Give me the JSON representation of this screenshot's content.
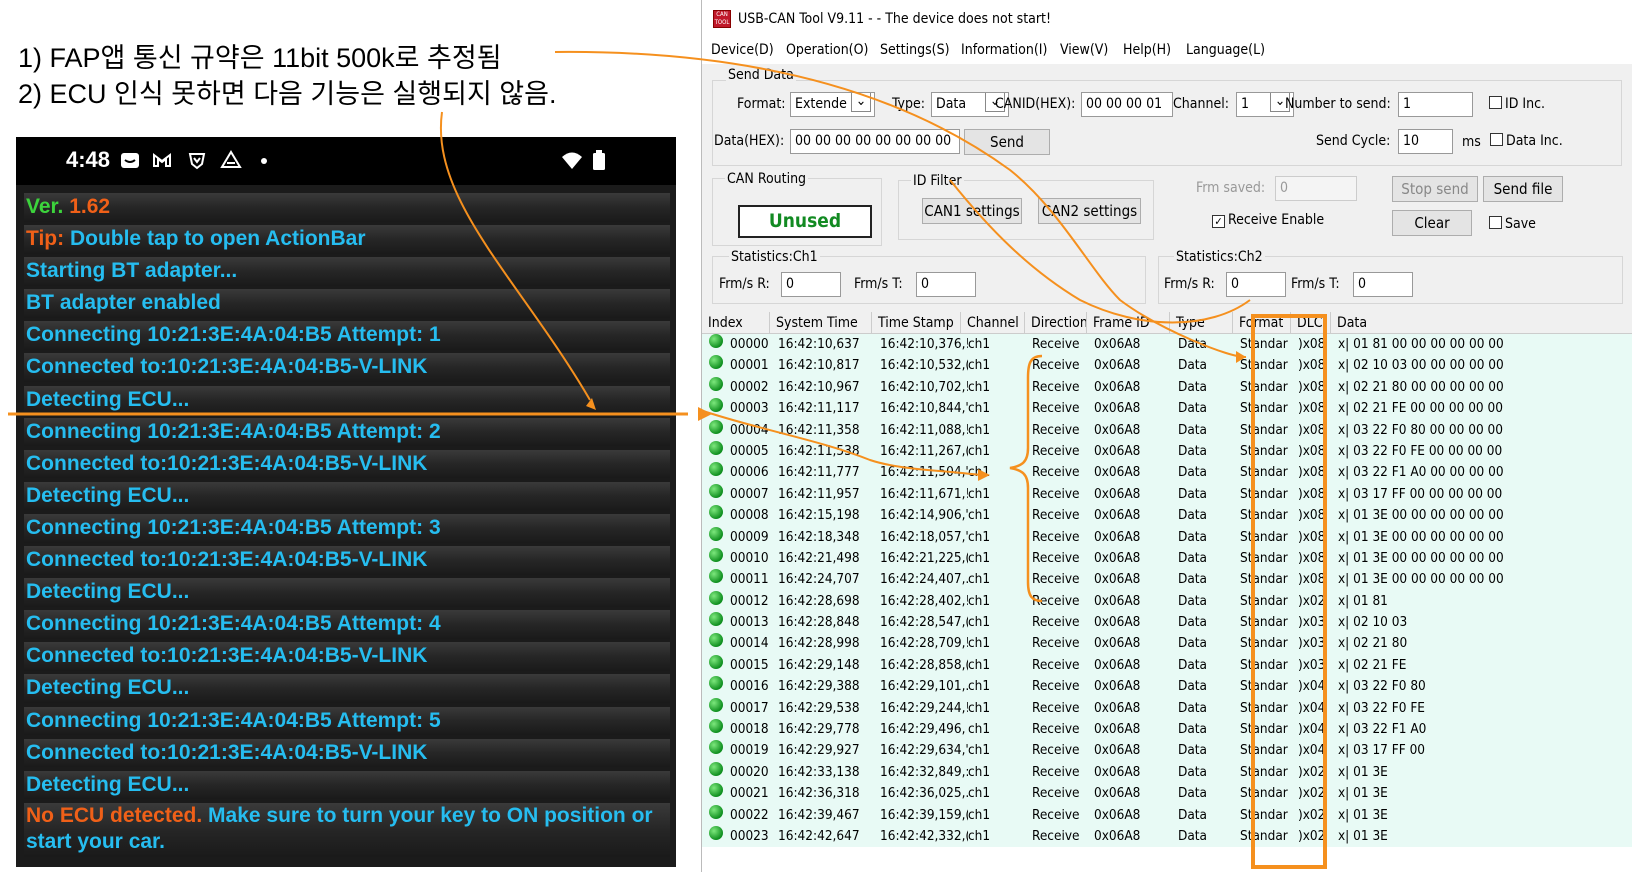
{
  "notes": [
    "1) FAP앱 통신 규약은 11bit 500k로 추정됨",
    "2) ECU 인식 못하면 다음 기능은 실행되지 않음."
  ],
  "phone": {
    "time": "4:48",
    "status_icons": [
      "notification-icon",
      "gmail-icon",
      "vpn-icon",
      "drive-icon",
      "dot-icon",
      "wifi-icon",
      "battery-icon"
    ],
    "log": [
      {
        "a": "Ver. ",
        "b": "1.62",
        "ac": "grn",
        "bc": "org"
      },
      {
        "a": "Tip: ",
        "b": "Double tap to open ActionBar",
        "ac": "org",
        "bc": ""
      },
      {
        "a": "Starting BT adapter...",
        "b": "",
        "ac": "",
        "bc": ""
      },
      {
        "a": "BT adapter enabled",
        "b": "",
        "ac": "",
        "bc": ""
      },
      {
        "a": "Connecting 10:21:3E:4A:04:B5 Attempt: 1",
        "b": "",
        "ac": "",
        "bc": ""
      },
      {
        "a": "Connected to:10:21:3E:4A:04:B5-V-LINK",
        "b": "",
        "ac": "",
        "bc": ""
      },
      {
        "a": "Detecting ECU...",
        "b": "",
        "ac": "",
        "bc": ""
      },
      {
        "a": "Connecting 10:21:3E:4A:04:B5 Attempt: 2",
        "b": "",
        "ac": "",
        "bc": ""
      },
      {
        "a": "Connected to:10:21:3E:4A:04:B5-V-LINK",
        "b": "",
        "ac": "",
        "bc": ""
      },
      {
        "a": "Detecting ECU...",
        "b": "",
        "ac": "",
        "bc": ""
      },
      {
        "a": "Connecting 10:21:3E:4A:04:B5 Attempt: 3",
        "b": "",
        "ac": "",
        "bc": ""
      },
      {
        "a": "Connected to:10:21:3E:4A:04:B5-V-LINK",
        "b": "",
        "ac": "",
        "bc": ""
      },
      {
        "a": "Detecting ECU...",
        "b": "",
        "ac": "",
        "bc": ""
      },
      {
        "a": "Connecting 10:21:3E:4A:04:B5 Attempt: 4",
        "b": "",
        "ac": "",
        "bc": ""
      },
      {
        "a": "Connected to:10:21:3E:4A:04:B5-V-LINK",
        "b": "",
        "ac": "",
        "bc": ""
      },
      {
        "a": "Detecting ECU...",
        "b": "",
        "ac": "",
        "bc": ""
      },
      {
        "a": "Connecting 10:21:3E:4A:04:B5 Attempt: 5",
        "b": "",
        "ac": "",
        "bc": ""
      },
      {
        "a": "Connected to:10:21:3E:4A:04:B5-V-LINK",
        "b": "",
        "ac": "",
        "bc": ""
      },
      {
        "a": "Detecting ECU...",
        "b": "",
        "ac": "",
        "bc": ""
      },
      {
        "a": "No ECU detected. ",
        "b": "Make sure to turn your key to ON position or start your car.",
        "ac": "org",
        "bc": ""
      }
    ]
  },
  "win": {
    "title": "USB-CAN Tool V9.11 -  - The device does not start!",
    "menu": [
      "Device(D)",
      "Operation(O)",
      "Settings(S)",
      "Information(I)",
      "View(V)",
      "Help(H)",
      "Language(L)"
    ],
    "send": {
      "group": "Send Data",
      "format_label": "Format:",
      "format": "Extende",
      "type_label": "Type:",
      "type": "Data",
      "canid_label": "CANID(HEX):",
      "canid": "00 00 00 01",
      "channel_label": "Channel:",
      "channel": "1",
      "number_label": "Number to send:",
      "number": "1",
      "idinc": "ID Inc.",
      "data_label": "Data(HEX):",
      "data": "00 00 00 00 00 00 00 00",
      "send_btn": "Send",
      "cycle_label": "Send Cycle:",
      "cycle": "10",
      "ms": "ms",
      "datainc": "Data Inc."
    },
    "routing": {
      "group": "CAN Routing",
      "value": "Unused"
    },
    "filter": {
      "group": "ID Filter",
      "can1": "CAN1 settings",
      "can2": "CAN2 settings"
    },
    "frm_saved_label": "Frm saved:",
    "frm_saved": "0",
    "stop_send": "Stop send",
    "send_file": "Send file",
    "receive_enable": "Receive Enable",
    "clear": "Clear",
    "save": "Save",
    "stat1": {
      "group": "Statistics:Ch1",
      "r_label": "Frm/s R:",
      "r": "0",
      "t_label": "Frm/s T:",
      "t": "0"
    },
    "stat2": {
      "group": "Statistics:Ch2",
      "r_label": "Frm/s R:",
      "r": "0",
      "t_label": "Frm/s T:",
      "t": "0"
    },
    "columns": [
      "Index",
      "System Time",
      "Time Stamp",
      "Channel",
      "Direction",
      "Frame ID",
      "Type",
      "Format",
      "DLC",
      "Data"
    ],
    "rows": [
      [
        "00000",
        "16:42:10,637",
        "16:42:10,376,!",
        "ch1",
        "Receive",
        "0x06A8",
        "Data",
        "Standar",
        ")x08",
        "x| 01 81 00 00 00 00 00 00"
      ],
      [
        "00001",
        "16:42:10,817",
        "16:42:10,532,(",
        "ch1",
        "Receive",
        "0x06A8",
        "Data",
        "Standar",
        ")x08",
        "x| 02 10 03 00 00 00 00 00"
      ],
      [
        "00002",
        "16:42:10,967",
        "16:42:10,702,!",
        "ch1",
        "Receive",
        "0x06A8",
        "Data",
        "Standar",
        ")x08",
        "x| 02 21 80 00 00 00 00 00"
      ],
      [
        "00003",
        "16:42:11,117",
        "16:42:10,844,'",
        "ch1",
        "Receive",
        "0x06A8",
        "Data",
        "Standar",
        ")x08",
        "x| 02 21 FE 00 00 00 00 00"
      ],
      [
        "00004",
        "16:42:11,358",
        "16:42:11,088,!",
        "ch1",
        "Receive",
        "0x06A8",
        "Data",
        "Standar",
        ")x08",
        "x| 03 22 F0 80 00 00 00 00"
      ],
      [
        "00005",
        "16:42:11,538",
        "16:42:11,267,(",
        "ch1",
        "Receive",
        "0x06A8",
        "Data",
        "Standar",
        ")x08",
        "x| 03 22 F0 FE 00 00 00 00"
      ],
      [
        "00006",
        "16:42:11,777",
        "16:42:11,504,'",
        "ch1",
        "Receive",
        "0x06A8",
        "Data",
        "Standar",
        ")x08",
        "x| 03 22 F1 A0 00 00 00 00"
      ],
      [
        "00007",
        "16:42:11,957",
        "16:42:11,671,!",
        "ch1",
        "Receive",
        "0x06A8",
        "Data",
        "Standar",
        ")x08",
        "x| 03 17 FF 00 00 00 00 00"
      ],
      [
        "00008",
        "16:42:15,198",
        "16:42:14,906,'",
        "ch1",
        "Receive",
        "0x06A8",
        "Data",
        "Standar",
        ")x08",
        "x| 01 3E 00 00 00 00 00 00"
      ],
      [
        "00009",
        "16:42:18,348",
        "16:42:18,057,'",
        "ch1",
        "Receive",
        "0x06A8",
        "Data",
        "Standar",
        ")x08",
        "x| 01 3E 00 00 00 00 00 00"
      ],
      [
        "00010",
        "16:42:21,498",
        "16:42:21,225,(",
        "ch1",
        "Receive",
        "0x06A8",
        "Data",
        "Standar",
        ")x08",
        "x| 01 3E 00 00 00 00 00 00"
      ],
      [
        "00011",
        "16:42:24,707",
        "16:42:24,407,.",
        "ch1",
        "Receive",
        "0x06A8",
        "Data",
        "Standar",
        ")x08",
        "x| 01 3E 00 00 00 00 00 00"
      ],
      [
        "00012",
        "16:42:28,698",
        "16:42:28,402,!",
        "ch1",
        "Receive",
        "0x06A8",
        "Data",
        "Standar",
        ")x02",
        "x| 01 81"
      ],
      [
        "00013",
        "16:42:28,848",
        "16:42:28,547,(",
        "ch1",
        "Receive",
        "0x06A8",
        "Data",
        "Standar",
        ")x03",
        "x| 02 10 03"
      ],
      [
        "00014",
        "16:42:28,998",
        "16:42:28,709,!",
        "ch1",
        "Receive",
        "0x06A8",
        "Data",
        "Standar",
        ")x03",
        "x| 02 21 80"
      ],
      [
        "00015",
        "16:42:29,148",
        "16:42:28,858,(",
        "ch1",
        "Receive",
        "0x06A8",
        "Data",
        "Standar",
        ")x03",
        "x| 02 21 FE"
      ],
      [
        "00016",
        "16:42:29,388",
        "16:42:29,101,.",
        "ch1",
        "Receive",
        "0x06A8",
        "Data",
        "Standar",
        ")x04",
        "x| 03 22 F0 80"
      ],
      [
        "00017",
        "16:42:29,538",
        "16:42:29,244,!",
        "ch1",
        "Receive",
        "0x06A8",
        "Data",
        "Standar",
        ")x04",
        "x| 03 22 F0 FE"
      ],
      [
        "00018",
        "16:42:29,778",
        "16:42:29,496,",
        "ch1",
        "Receive",
        "0x06A8",
        "Data",
        "Standar",
        ")x04",
        "x| 03 22 F1 A0"
      ],
      [
        "00019",
        "16:42:29,927",
        "16:42:29,634,'",
        "ch1",
        "Receive",
        "0x06A8",
        "Data",
        "Standar",
        ")x04",
        "x| 03 17 FF 00"
      ],
      [
        "00020",
        "16:42:33,138",
        "16:42:32,849,:",
        "ch1",
        "Receive",
        "0x06A8",
        "Data",
        "Standar",
        ")x02",
        "x| 01 3E"
      ],
      [
        "00021",
        "16:42:36,318",
        "16:42:36,025,.",
        "ch1",
        "Receive",
        "0x06A8",
        "Data",
        "Standar",
        ")x02",
        "x| 01 3E"
      ],
      [
        "00022",
        "16:42:39,467",
        "16:42:39,159,(",
        "ch1",
        "Receive",
        "0x06A8",
        "Data",
        "Standar",
        ")x02",
        "x| 01 3E"
      ],
      [
        "00023",
        "16:42:42,647",
        "16:42:42,332,(",
        "ch1",
        "Receive",
        "0x06A8",
        "Data",
        "Standar",
        ")x02",
        "x| 01 3E"
      ]
    ]
  },
  "colors": {
    "annotation": "#f5901e",
    "log_text": "#26bdf0",
    "log_green": "#3cd43c",
    "log_orange": "#f06018",
    "routing_text": "#128a22",
    "rows_bg": "#e8faf5"
  }
}
